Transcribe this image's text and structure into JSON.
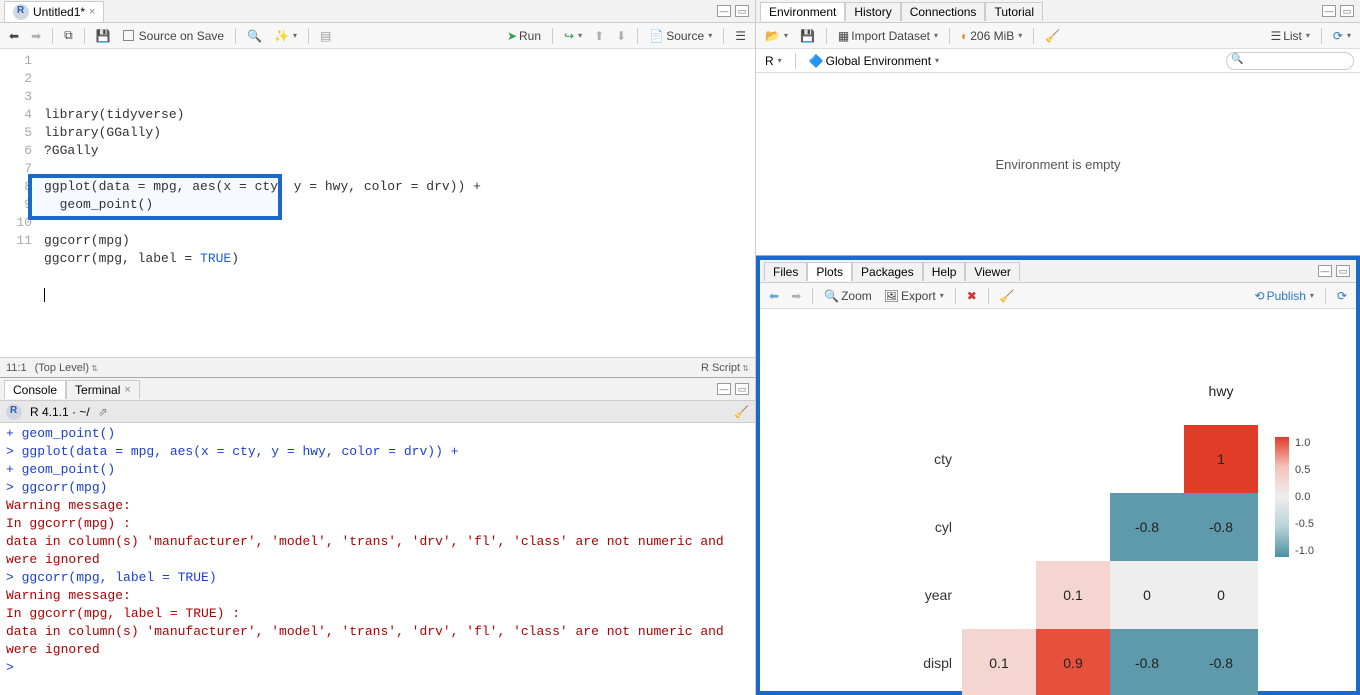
{
  "source": {
    "tab_title": "Untitled1*",
    "toolbar": {
      "source_on_save": "Source on Save",
      "run": "Run",
      "source_btn": "Source"
    },
    "lines": [
      "library(tidyverse)",
      "library(GGally)",
      "?GGally",
      "",
      "ggplot(data = mpg, aes(x = cty, y = hwy, color = drv)) +",
      "  geom_point()",
      "",
      "ggcorr(mpg)",
      "ggcorr(mpg, label = TRUE)",
      "",
      ""
    ],
    "highlight_true": "TRUE",
    "status": {
      "pos": "11:1",
      "scope": "(Top Level)",
      "type": "R Script"
    }
  },
  "console": {
    "tabs": [
      "Console",
      "Terminal"
    ],
    "header": "R 4.1.1 · ~/",
    "lines": [
      {
        "cls": "con-plus",
        "text": "+   geom_point()"
      },
      {
        "cls": "con-cmd",
        "text": "> ggplot(data = mpg, aes(x = cty, y = hwy, color = drv)) +"
      },
      {
        "cls": "con-plus",
        "text": "+   geom_point()"
      },
      {
        "cls": "con-cmd",
        "text": "> ggcorr(mpg)"
      },
      {
        "cls": "con-warn",
        "text": "Warning message:"
      },
      {
        "cls": "con-warn",
        "text": "In ggcorr(mpg) :"
      },
      {
        "cls": "con-warn",
        "text": "  data in column(s) 'manufacturer', 'model', 'trans', 'drv', 'fl', 'class' are not numeric and were ignored"
      },
      {
        "cls": "con-cmd",
        "text": "> ggcorr(mpg, label = TRUE)"
      },
      {
        "cls": "con-warn",
        "text": "Warning message:"
      },
      {
        "cls": "con-warn",
        "text": "In ggcorr(mpg, label = TRUE) :"
      },
      {
        "cls": "con-warn",
        "text": "  data in column(s) 'manufacturer', 'model', 'trans', 'drv', 'fl', 'class' are not numeric and were ignored"
      },
      {
        "cls": "con-cmd",
        "text": "> "
      }
    ]
  },
  "env": {
    "tabs": [
      "Environment",
      "History",
      "Connections",
      "Tutorial"
    ],
    "import": "Import Dataset",
    "mem": "206 MiB",
    "list": "List",
    "scope_r": "R",
    "scope": "Global Environment",
    "empty": "Environment is empty"
  },
  "plots": {
    "tabs": [
      "Files",
      "Plots",
      "Packages",
      "Help",
      "Viewer"
    ],
    "zoom": "Zoom",
    "export": "Export",
    "publish": "Publish"
  },
  "chart_data": {
    "type": "heatmap",
    "title": "",
    "variables": [
      "displ",
      "year",
      "cyl",
      "cty",
      "hwy"
    ],
    "top_labels": [
      "hwy",
      "cty",
      "cyl",
      "year",
      "displ"
    ],
    "cells": [
      {
        "row": "cty",
        "col": "hwy",
        "value": 1,
        "color": "#e03c28"
      },
      {
        "row": "cyl",
        "col": "cty",
        "value": -0.8,
        "color": "#5e9aac"
      },
      {
        "row": "cyl",
        "col": "hwy",
        "value": -0.8,
        "color": "#5e9aac"
      },
      {
        "row": "year",
        "col": "cyl",
        "value": 0.1,
        "color": "#f4d5d0"
      },
      {
        "row": "year",
        "col": "cty",
        "value": 0,
        "color": "#eeeeee"
      },
      {
        "row": "year",
        "col": "hwy",
        "value": 0,
        "color": "#eeeeee"
      },
      {
        "row": "displ",
        "col": "year",
        "value": 0.1,
        "color": "#f4d5d0"
      },
      {
        "row": "displ",
        "col": "cyl",
        "value": 0.9,
        "color": "#e5513c"
      },
      {
        "row": "displ",
        "col": "cty",
        "value": -0.8,
        "color": "#5e9aac"
      },
      {
        "row": "displ",
        "col": "hwy",
        "value": -0.8,
        "color": "#5e9aac"
      }
    ],
    "legend": {
      "min": -1.0,
      "max": 1.0,
      "ticks": [
        "1.0",
        "0.5",
        "0.0",
        "-0.5",
        "-1.0"
      ]
    }
  }
}
